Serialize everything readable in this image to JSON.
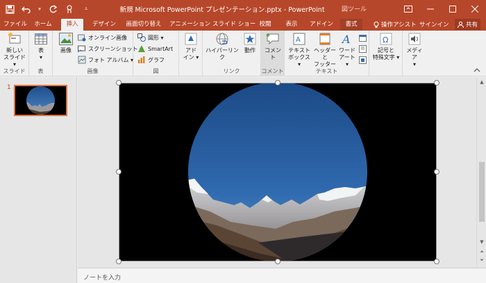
{
  "window": {
    "title": "新規 Microsoft PowerPoint プレゼンテーション.pptx - PowerPoint",
    "tool_group": "図ツール",
    "controls": [
      "restore-ribbon",
      "minimize",
      "maximize",
      "close"
    ]
  },
  "quick_access": [
    "save-icon",
    "undo-icon",
    "redo-icon",
    "touch-mode-icon",
    "customize-icon"
  ],
  "tabs": [
    "ファイル",
    "ホーム",
    "挿入",
    "デザイン",
    "画面切り替え",
    "アニメーション",
    "スライド ショー",
    "校閲",
    "表示",
    "アドイン",
    "書式"
  ],
  "active_tab": "挿入",
  "tell_me": "操作アシスト",
  "sign_in": "サインイン",
  "share": "共有",
  "ribbon": {
    "slides": {
      "label": "スライド",
      "new_slide_line1": "新しい",
      "new_slide_line2": "スライド"
    },
    "tables": {
      "label": "表",
      "table": "表"
    },
    "images": {
      "label": "画像",
      "pictures": "画像",
      "online_pictures": "オンライン画像",
      "screenshot": "スクリーンショット",
      "photo_album": "フォト アルバム"
    },
    "illustrations": {
      "label": "図",
      "shapes": "図形",
      "smartart": "SmartArt",
      "chart": "グラフ"
    },
    "addins": {
      "line1": "アド",
      "line2": "イン"
    },
    "links": {
      "label": "リンク",
      "hyperlink": "ハイパーリンク",
      "action": "動作"
    },
    "comments": {
      "label": "コメント",
      "comment": "コメント"
    },
    "text": {
      "label": "テキスト",
      "textbox_line1": "テキスト",
      "textbox_line2": "ボックス",
      "header_line1": "ヘッダーと",
      "header_line2": "フッター",
      "wordart_line1": "ワード",
      "wordart_line2": "アート"
    },
    "symbols": {
      "line1": "記号と",
      "line2": "特殊文字"
    },
    "media": {
      "label": "メディア"
    }
  },
  "thumbnails": {
    "slide_number": "1"
  },
  "notes": {
    "placeholder": "ノートを入力"
  },
  "colors": {
    "accent": "#b7472a",
    "selected_thumb_border": "#e07040"
  }
}
